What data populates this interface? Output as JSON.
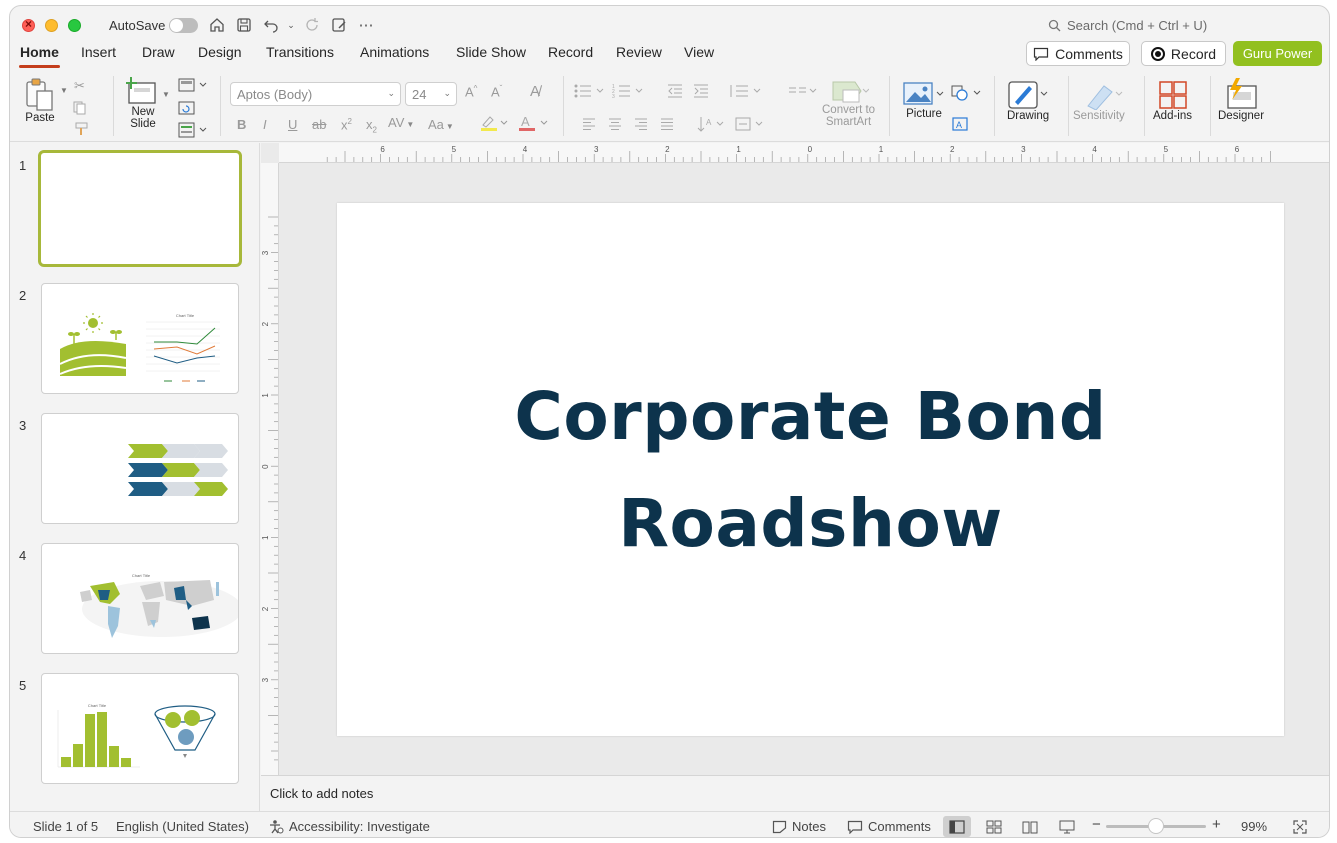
{
  "titlebar": {
    "autosave_label": "AutoSave",
    "search_placeholder": "Search (Cmd + Ctrl + U)"
  },
  "tabs": [
    "Home",
    "Insert",
    "Draw",
    "Design",
    "Transitions",
    "Animations",
    "Slide Show",
    "Record",
    "Review",
    "View"
  ],
  "actions": {
    "comments": "Comments",
    "record": "Record",
    "guru": "Guru Power"
  },
  "ribbon": {
    "paste": "Paste",
    "new_slide_1": "New",
    "new_slide_2": "Slide",
    "font_name": "Aptos (Body)",
    "font_size": "24",
    "convert_1": "Convert to",
    "convert_2": "SmartArt",
    "picture": "Picture",
    "drawing": "Drawing",
    "sensitivity": "Sensitivity",
    "addins": "Add-ins",
    "designer": "Designer"
  },
  "thumbnails": {
    "numbers": [
      "1",
      "2",
      "3",
      "4",
      "5"
    ],
    "chart_title_small": "Chart Title"
  },
  "ruler": {
    "h_labels": [
      "6",
      "5",
      "4",
      "3",
      "2",
      "1",
      "0",
      "1",
      "2",
      "3",
      "4",
      "5",
      "6"
    ],
    "v_labels": [
      "3",
      "2",
      "1",
      "0",
      "1",
      "2",
      "3"
    ]
  },
  "slide": {
    "title_line1": "Corporate Bond",
    "title_line2": "Roadshow"
  },
  "notes_placeholder": "Click to add notes",
  "status": {
    "slide_counter": "Slide 1 of 5",
    "language": "English (United States)",
    "accessibility": "Accessibility: Investigate",
    "notes": "Notes",
    "comments": "Comments",
    "zoom": "99%"
  },
  "colors": {
    "accent_green": "#92c01f",
    "title_navy": "#0d334c",
    "tab_underline": "#c43e1c",
    "chevron_blue": "#1f5d84"
  }
}
